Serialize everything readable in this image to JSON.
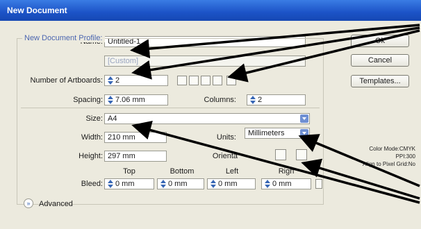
{
  "window": {
    "title": "New Document"
  },
  "form": {
    "name": {
      "label": "Name:",
      "value": "Untitled-1"
    },
    "profile": {
      "group_label": "New Document Profile:",
      "value": "[Custom]"
    },
    "artboards": {
      "label": "Number of Artboards:",
      "value": "2"
    },
    "spacing": {
      "label": "Spacing:",
      "value": "7.06 mm"
    },
    "columns": {
      "label": "Columns:",
      "value": "2"
    },
    "size": {
      "label": "Size:",
      "value": "A4"
    },
    "width": {
      "label": "Width:",
      "value": "210 mm"
    },
    "height": {
      "label": "Height:",
      "value": "297 mm"
    },
    "units": {
      "label": "Units:",
      "value": "Millimeters"
    },
    "orientation": {
      "label": "Orienta"
    },
    "bleed": {
      "label": "Bleed:",
      "headers": [
        "Top",
        "Bottom",
        "Left",
        "Righ"
      ],
      "values": [
        "0 mm",
        "0 mm",
        "0 mm",
        "0 mm"
      ]
    },
    "advanced": {
      "label": "Advanced"
    }
  },
  "buttons": {
    "ok": "Ok",
    "cancel": "Cancel",
    "templates": "Templates..."
  },
  "info": {
    "color_mode": "Color Mode:CMYK",
    "ppi": "PPI:300",
    "align": "Align to Pixel Grid:No"
  },
  "colors": {
    "title_bar": "#1c53c7",
    "dialog_bg": "#eceade",
    "accent": "#3867b5"
  }
}
